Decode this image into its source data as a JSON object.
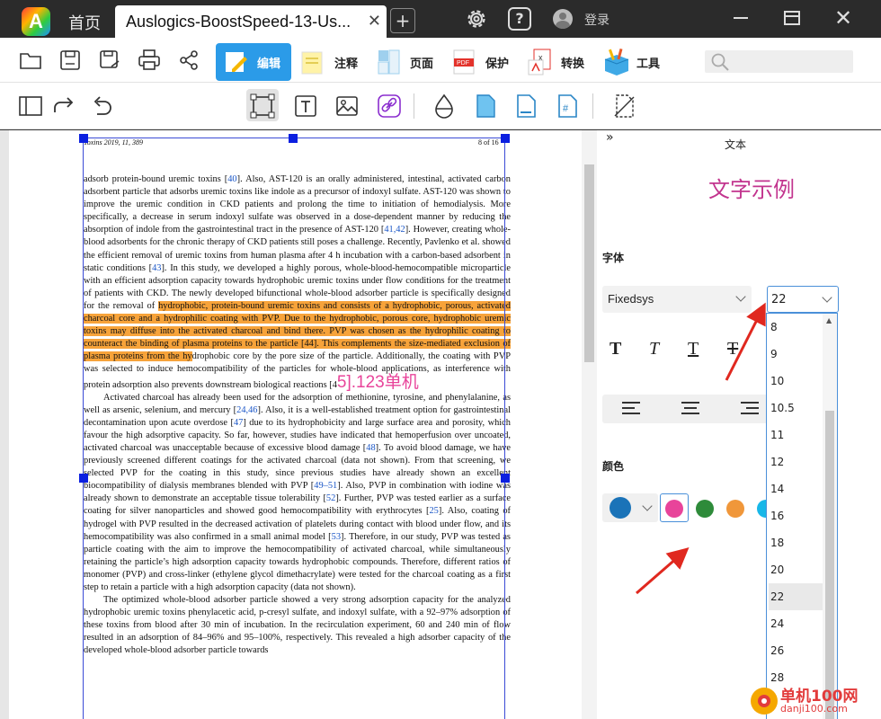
{
  "titlebar": {
    "home_tab": "首页",
    "doc_tab": "Auslogics-BoostSpeed-13-Us...",
    "login": "登录"
  },
  "toolbar1": {
    "edit": "编辑",
    "annotate": "注释",
    "page": "页面",
    "protect": "保护",
    "convert": "转换",
    "tools": "工具",
    "search_placeholder": ""
  },
  "document": {
    "header_left": "Toxins 2019, 11, 389",
    "header_right": "8 of 16",
    "p1_a": "adsorb protein-bound uremic toxins [",
    "ref40": "40",
    "p1_b": "]. Also, AST-120 is an orally administered, intestinal, activated carbon adsorbent particle that adsorbs uremic toxins like indole as a precursor of indoxyl sulfate. AST-120 was shown to improve the uremic condition in CKD patients and prolong the time to initiation of hemodialysis. More specifically, a decrease in serum indoxyl sulfate was observed in a dose-dependent manner by reducing the absorption of indole from the gastrointestinal tract in the presence of AST-120 [",
    "ref41": "41,42",
    "p1_c": "]. However, creating whole-blood adsorbents for the chronic therapy of CKD patients still poses a challenge. Recently, Pavlenko et al. showed the efficient removal of uremic toxins from human plasma after 4 h incubation with a carbon-based adsorbent in static conditions [",
    "ref43": "43",
    "p1_d": "]. In this study, we developed a highly porous, whole-blood-hemocompatible microparticle with an efficient adsorption capacity towards hydrophobic uremic toxins under flow conditions for the treatment of patients with CKD. The newly developed bifunctional whole-blood adsorber particle is specifically designed for the removal of ",
    "p1_hl": "hydrophobic, protein-bound uremic toxins and consists of a hydrophobic, porous, activated charcoal core and a hydrophilic coating with PVP. Due to the hydrophobic, porous core, hydrophobic uremic toxins may diffuse into the activated charcoal and bind there.  PVP was chosen as the hydrophilic coating to counteract the binding of plasma proteins to the particle [44]. This complements the size-mediated exclusion of plasma proteins from the hy",
    "p1_e": "drophobic core by the pore size of the particle.  Additionally, the coating with PVP was selected to induce hemocompatibility of the particles for whole-blood applications, as interference with protein adsorption also prevents downstream biological reactions [4",
    "inserted": "5].123单机",
    "p2_a": "Activated charcoal has already been used for the adsorption of methionine, tyrosine, and phenylalanine, as well as arsenic, selenium, and mercury [",
    "ref24": "24,46",
    "p2_b": "]. Also, it is a well-established treatment option for gastrointestinal decontamination upon acute overdose [",
    "ref47": "47",
    "p2_c": "] due to its hydrophobicity and large surface area and porosity, which favour the high adsorptive capacity. So far, however, studies have indicated that hemoperfusion over uncoated, activated charcoal was unacceptable because of excessive blood damage [",
    "ref48": "48",
    "p2_d": "]. To avoid blood damage, we have previously screened different coatings for the activated charcoal (data not shown). From that screening, we selected PVP for the coating in this study, since previous studies have already shown an excellent biocompatibility of dialysis membranes blended with PVP [",
    "ref49": "49–51",
    "p2_e": "]. Also, PVP in combination with iodine was already shown to demonstrate an acceptable tissue tolerability [",
    "ref52": "52",
    "p2_f": "]. Further, PVP was tested earlier as a surface coating for silver nanoparticles and showed good hemocompatibility with erythrocytes [",
    "ref25": "25",
    "p2_g": "]. Also, coating of hydrogel with PVP resulted in the decreased activation of platelets during contact with blood under flow, and its hemocompatibility was also confirmed in a small animal model [",
    "ref53": "53",
    "p2_h": "]. Therefore, in our study, PVP was tested as particle coating with the aim to improve the hemocompatibility of activated charcoal, while simultaneously retaining the particle’s high adsorption capacity towards hydrophobic compounds. Therefore, different ratios of monomer (PVP) and cross-linker (ethylene glycol dimethacrylate) were tested for the charcoal coating as a first step to retain a particle with a high adsorption capacity (data not shown).",
    "p3": "The optimized whole-blood adsorber particle showed a very strong adsorption capacity for the analyzed hydrophobic uremic toxins phenylacetic acid, p-cresyl sulfate, and indoxyl sulfate, with a 92–97% adsorption of these toxins from blood after 30 min of incubation.  In the recirculation experiment, 60 and 240 min of flow resulted in an adsorption of 84–96% and 95–100%, respectively. This revealed a high adsorber capacity of the developed whole-blood adsorber particle towards"
  },
  "panel": {
    "collapse": "»",
    "title": "文本",
    "sample": "文字示例",
    "font_label": "字体",
    "font_value": "Fixedsys",
    "size_value": "22",
    "style_bold": "T",
    "style_italic": "T",
    "style_underline": "T",
    "style_strike": "T",
    "color_label": "颜色",
    "size_options": [
      "8",
      "9",
      "10",
      "10.5",
      "11",
      "12",
      "14",
      "16",
      "18",
      "20",
      "22",
      "24",
      "26",
      "28"
    ],
    "selected_size": "22"
  },
  "colors": {
    "picker": "#1a73b8",
    "pink": "#e8449a",
    "green": "#2e8b3a",
    "orange": "#f0973a",
    "cyan": "#18b7e8"
  },
  "watermark": {
    "text": "单机100网",
    "url": "danji100.com"
  }
}
